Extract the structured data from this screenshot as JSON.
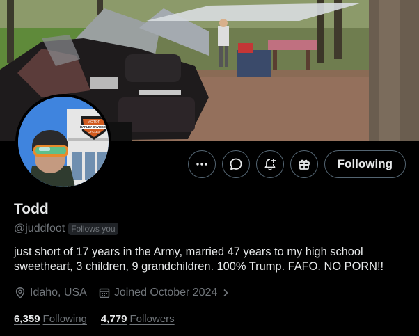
{
  "profile": {
    "name": "Todd",
    "handle": "@juddfoot",
    "follows_you_badge": "Follows you",
    "bio": "just short of 17 years in the Army, married 47 years to my high school sweetheart, 3 children, 9 grandchildren. 100% Trump. FAFO. NO PORN!!",
    "location": "Idaho, USA",
    "joined": "Joined October 2024",
    "following_count": "6,359",
    "following_label": "Following",
    "followers_count": "4,779",
    "followers_label": "Followers"
  },
  "actions": {
    "more_icon": "more-horizontal-icon",
    "message_icon": "message-bubble-icon",
    "notify_icon": "bell-plus-icon",
    "subscribe_icon": "gift-icon",
    "follow_button_label": "Following"
  },
  "avatar_sign": {
    "line1": "MOTOR",
    "line2": "HARLEY-DAVIDSON",
    "line3": "CYCLES"
  },
  "colors": {
    "background": "#000000",
    "text_primary": "#e7e9ea",
    "text_secondary": "#71767b",
    "button_border": "#536471",
    "badge_bg": "#202327"
  }
}
